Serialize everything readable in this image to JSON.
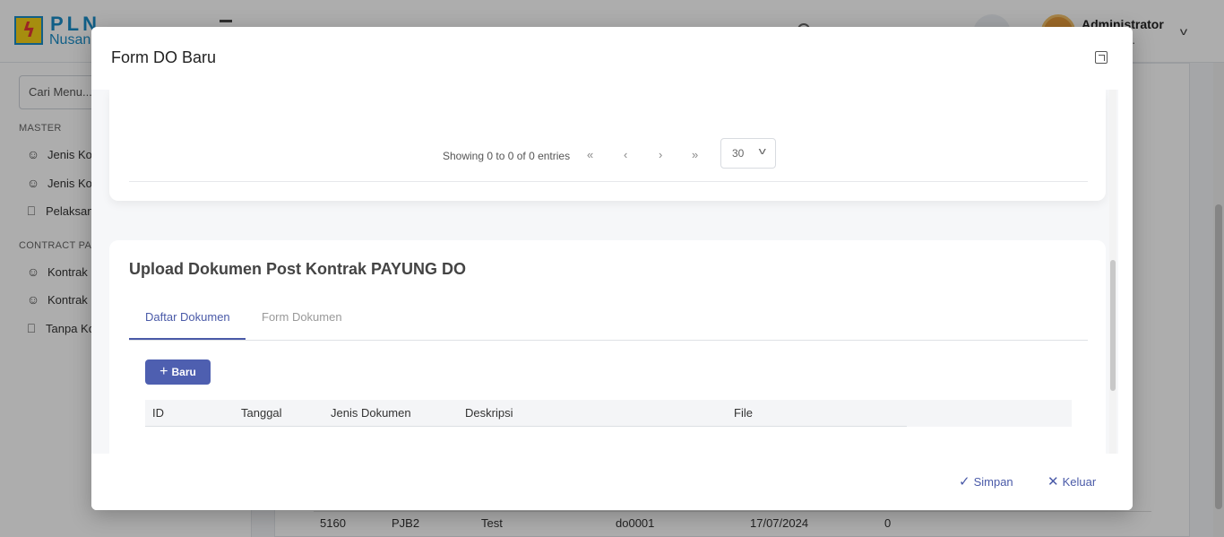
{
  "app": {
    "logo_text": "PLN",
    "logo_sub": "Nusan",
    "user": {
      "name": "Administrator",
      "role": "ADMIN, ..."
    }
  },
  "sidebar": {
    "search_placeholder": "Cari Menu...",
    "sections": [
      {
        "label": "MASTER",
        "items": [
          "Jenis Ko",
          "Jenis Ko",
          "Pelaksan"
        ]
      },
      {
        "label": "CONTRACT PA",
        "items": [
          "Kontrak",
          "Kontrak",
          "Tanpa Ko"
        ]
      }
    ]
  },
  "background_table_row": [
    "5160",
    "PJB2",
    "Test",
    "do0001",
    "17/07/2024",
    "0"
  ],
  "modal": {
    "title": "Form DO Baru",
    "pager": {
      "info": "Showing 0 to 0 of 0 entries",
      "first": "«",
      "prev": "‹",
      "next": "›",
      "last": "»",
      "page_size": "30"
    },
    "upload_section": {
      "title": "Upload Dokumen Post Kontrak PAYUNG DO",
      "tabs": [
        {
          "label": "Daftar Dokumen",
          "active": true
        },
        {
          "label": "Form Dokumen",
          "active": false
        }
      ],
      "new_button": "Baru",
      "table_headers": [
        "ID",
        "Tanggal",
        "Jenis Dokumen",
        "Deskripsi",
        "File"
      ]
    },
    "footer": {
      "save_label": "Simpan",
      "exit_label": "Keluar"
    }
  },
  "colors": {
    "accent": "#4a5aa8",
    "brand": "#1a8dc7",
    "button": "#4e5fb0"
  }
}
